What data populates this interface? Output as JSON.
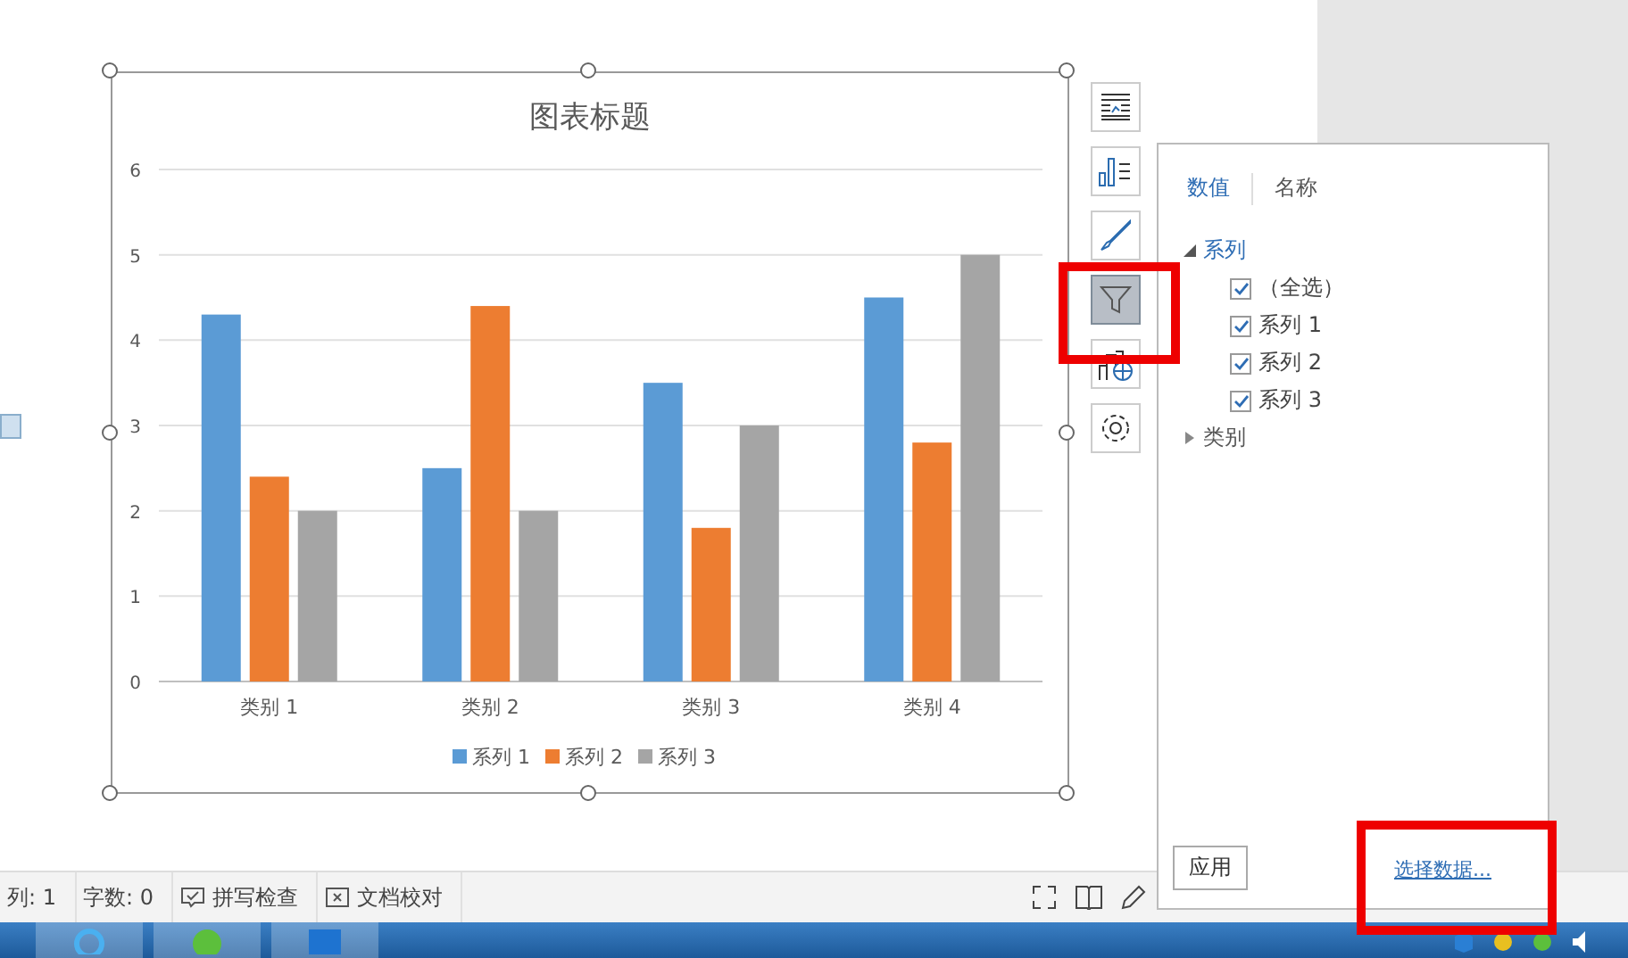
{
  "chart": {
    "chart_data": {
      "type": "bar",
      "title": "图表标题",
      "categories": [
        "类别 1",
        "类别 2",
        "类别 3",
        "类别 4"
      ],
      "series": [
        {
          "name": "系列 1",
          "color": "#5b9bd5",
          "values": [
            4.3,
            2.5,
            3.5,
            4.5
          ]
        },
        {
          "name": "系列 2",
          "color": "#ed7d31",
          "values": [
            2.4,
            4.4,
            1.8,
            2.8
          ]
        },
        {
          "name": "系列 3",
          "color": "#a5a5a5",
          "values": [
            2,
            2,
            3,
            5
          ]
        }
      ],
      "ylim": [
        0,
        6
      ],
      "yticks": [
        0,
        1,
        2,
        3,
        4,
        5,
        6
      ],
      "grid": true,
      "legend": true
    }
  },
  "side_buttons": [
    {
      "kind": "layout",
      "selected": false
    },
    {
      "kind": "elements",
      "selected": false
    },
    {
      "kind": "style",
      "selected": false
    },
    {
      "kind": "filter",
      "selected": true
    },
    {
      "kind": "online",
      "selected": false
    },
    {
      "kind": "settings",
      "selected": false
    }
  ],
  "filter_panel": {
    "tabs": [
      {
        "label": "数值",
        "selected": true
      },
      {
        "label": "名称",
        "selected": false
      }
    ],
    "tree": [
      {
        "label": "系列",
        "expanded": true,
        "children": [
          {
            "label": "（全选）",
            "checked": true
          },
          {
            "label": "系列 1",
            "checked": true
          },
          {
            "label": "系列 2",
            "checked": true
          },
          {
            "label": "系列 3",
            "checked": true
          }
        ]
      },
      {
        "label": "类别",
        "expanded": false
      }
    ],
    "apply_button": "应用",
    "select_data_link": "选择数据..."
  },
  "status_bar": {
    "items": [
      {
        "kind": "text",
        "label": "列: 1"
      },
      {
        "kind": "text",
        "label": "字数: 0"
      },
      {
        "kind": "spell",
        "label": "拼写检查"
      },
      {
        "kind": "proof",
        "label": "文档校对"
      }
    ]
  }
}
